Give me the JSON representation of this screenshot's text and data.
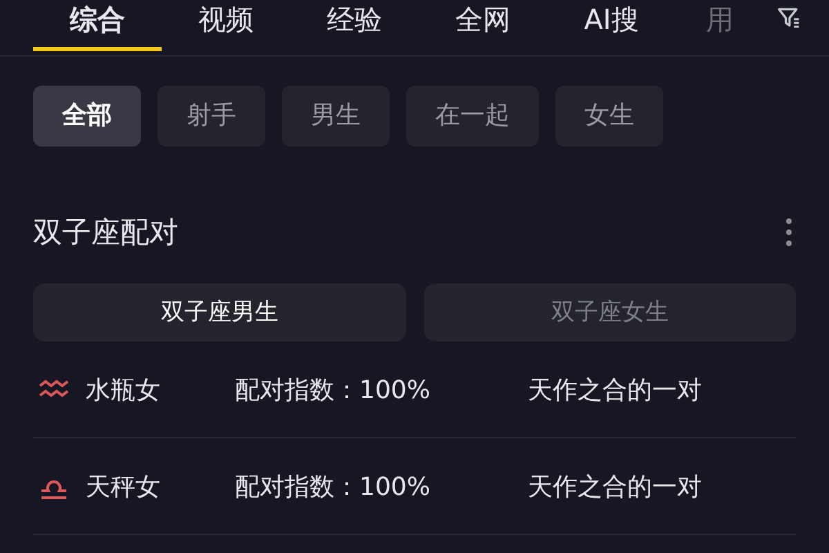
{
  "tabs": [
    {
      "label": "综合",
      "selected": true
    },
    {
      "label": "视频",
      "selected": false
    },
    {
      "label": "经验",
      "selected": false
    },
    {
      "label": "全网",
      "selected": false
    },
    {
      "label": "AI搜",
      "selected": false
    },
    {
      "label": "用",
      "selected": false
    }
  ],
  "filters": [
    {
      "label": "全部",
      "selected": true
    },
    {
      "label": "射手",
      "selected": false
    },
    {
      "label": "男生",
      "selected": false
    },
    {
      "label": "在一起",
      "selected": false
    },
    {
      "label": "女生",
      "selected": false
    }
  ],
  "section": {
    "title": "双子座配对",
    "toggles": [
      {
        "label": "双子座男生",
        "selected": true
      },
      {
        "label": "双子座女生",
        "selected": false
      }
    ],
    "rows": [
      {
        "kind": "aquarius",
        "name": "水瓶女",
        "score": "配对指数：100%",
        "verdict": "天作之合的一对"
      },
      {
        "kind": "libra",
        "name": "天秤女",
        "score": "配对指数：100%",
        "verdict": "天作之合的一对"
      }
    ]
  }
}
